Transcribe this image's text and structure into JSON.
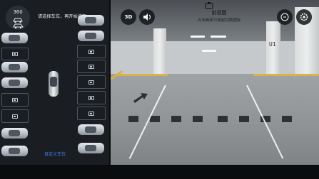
{
  "left_panel": {
    "top_button_badge": "360",
    "hint_text": "请选择车位，再开始泊车",
    "custom_slot_label": "自定义车位"
  },
  "camera_view": {
    "btn_3d_label": "3D",
    "view_title": "前视图",
    "view_subtitle": "点击画面可换起切换图标",
    "pillar_label": "U1"
  },
  "colors": {
    "accent": "#3b82f6",
    "panel_bg": "#1a1e23",
    "parking_line_yellow": "#d8b24a"
  },
  "icons": [
    "car-view-icon",
    "car-outline-icon",
    "parking-slot-icon",
    "speaker-icon",
    "camera-switch-icon",
    "settings-icon",
    "exit-icon"
  ]
}
